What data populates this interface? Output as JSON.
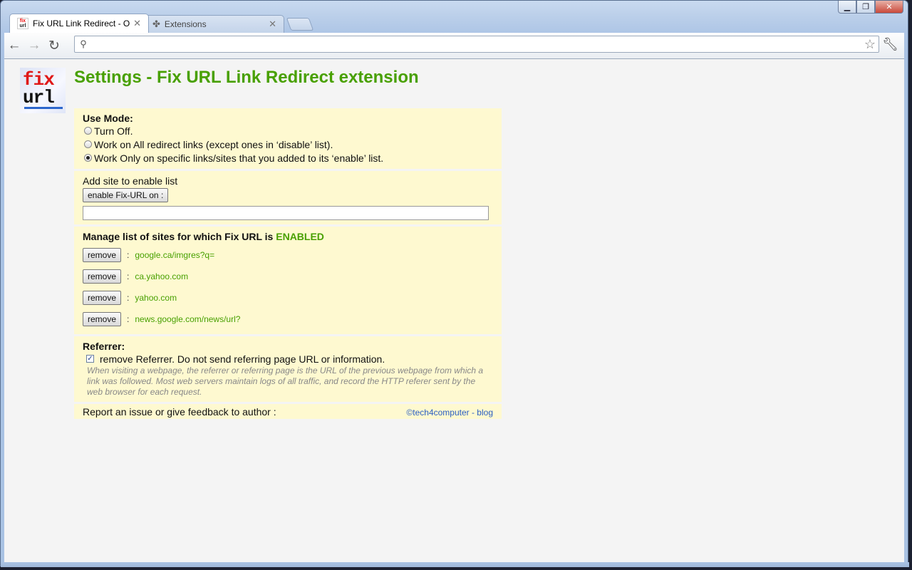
{
  "browser": {
    "tabs": [
      {
        "title": "Fix URL Link Redirect - Opt",
        "active": true,
        "icon": "fix-url-favicon"
      },
      {
        "title": "Extensions",
        "active": false,
        "icon": "puzzle-icon"
      }
    ],
    "address_value": "",
    "window_buttons": {
      "minimize": "▁",
      "maximize": "❐",
      "close": "✕"
    }
  },
  "logo": {
    "line1": "fix",
    "line2": "url"
  },
  "page": {
    "title": "Settings - Fix URL Link Redirect extension",
    "use_mode": {
      "heading": "Use Mode:",
      "options": [
        {
          "label": "Turn Off.",
          "selected": false
        },
        {
          "label": "Work on All redirect links (except ones in ‘disable’ list).",
          "selected": false
        },
        {
          "label": "Work Only on specific links/sites that you added to its ‘enable’ list.",
          "selected": true
        }
      ]
    },
    "add_site": {
      "label": "Add site to enable list",
      "button": "enable Fix-URL on :",
      "input_value": ""
    },
    "manage": {
      "heading": "Manage list of sites for which Fix URL is ",
      "status": "ENABLED",
      "remove_label": "remove",
      "sites": [
        "google.ca/imgres?q=",
        "ca.yahoo.com",
        "yahoo.com",
        "news.google.com/news/url?"
      ]
    },
    "referrer": {
      "heading": "Referrer:",
      "checkbox_label": "remove Referrer. Do not send referring page URL or information.",
      "checked": true,
      "description": "When visiting a webpage, the referrer or referring page is the URL of the previous webpage from which a link was followed. Most web servers maintain logs of all traffic, and record the HTTP referer sent by the web browser for each request."
    },
    "footer": {
      "report": "Report an issue or give feedback to author :",
      "credit": "©tech4computer - blog"
    }
  },
  "colors": {
    "accent_green": "#48a000",
    "panel_bg": "#fef9d0",
    "link_blue": "#2b5fc2"
  }
}
